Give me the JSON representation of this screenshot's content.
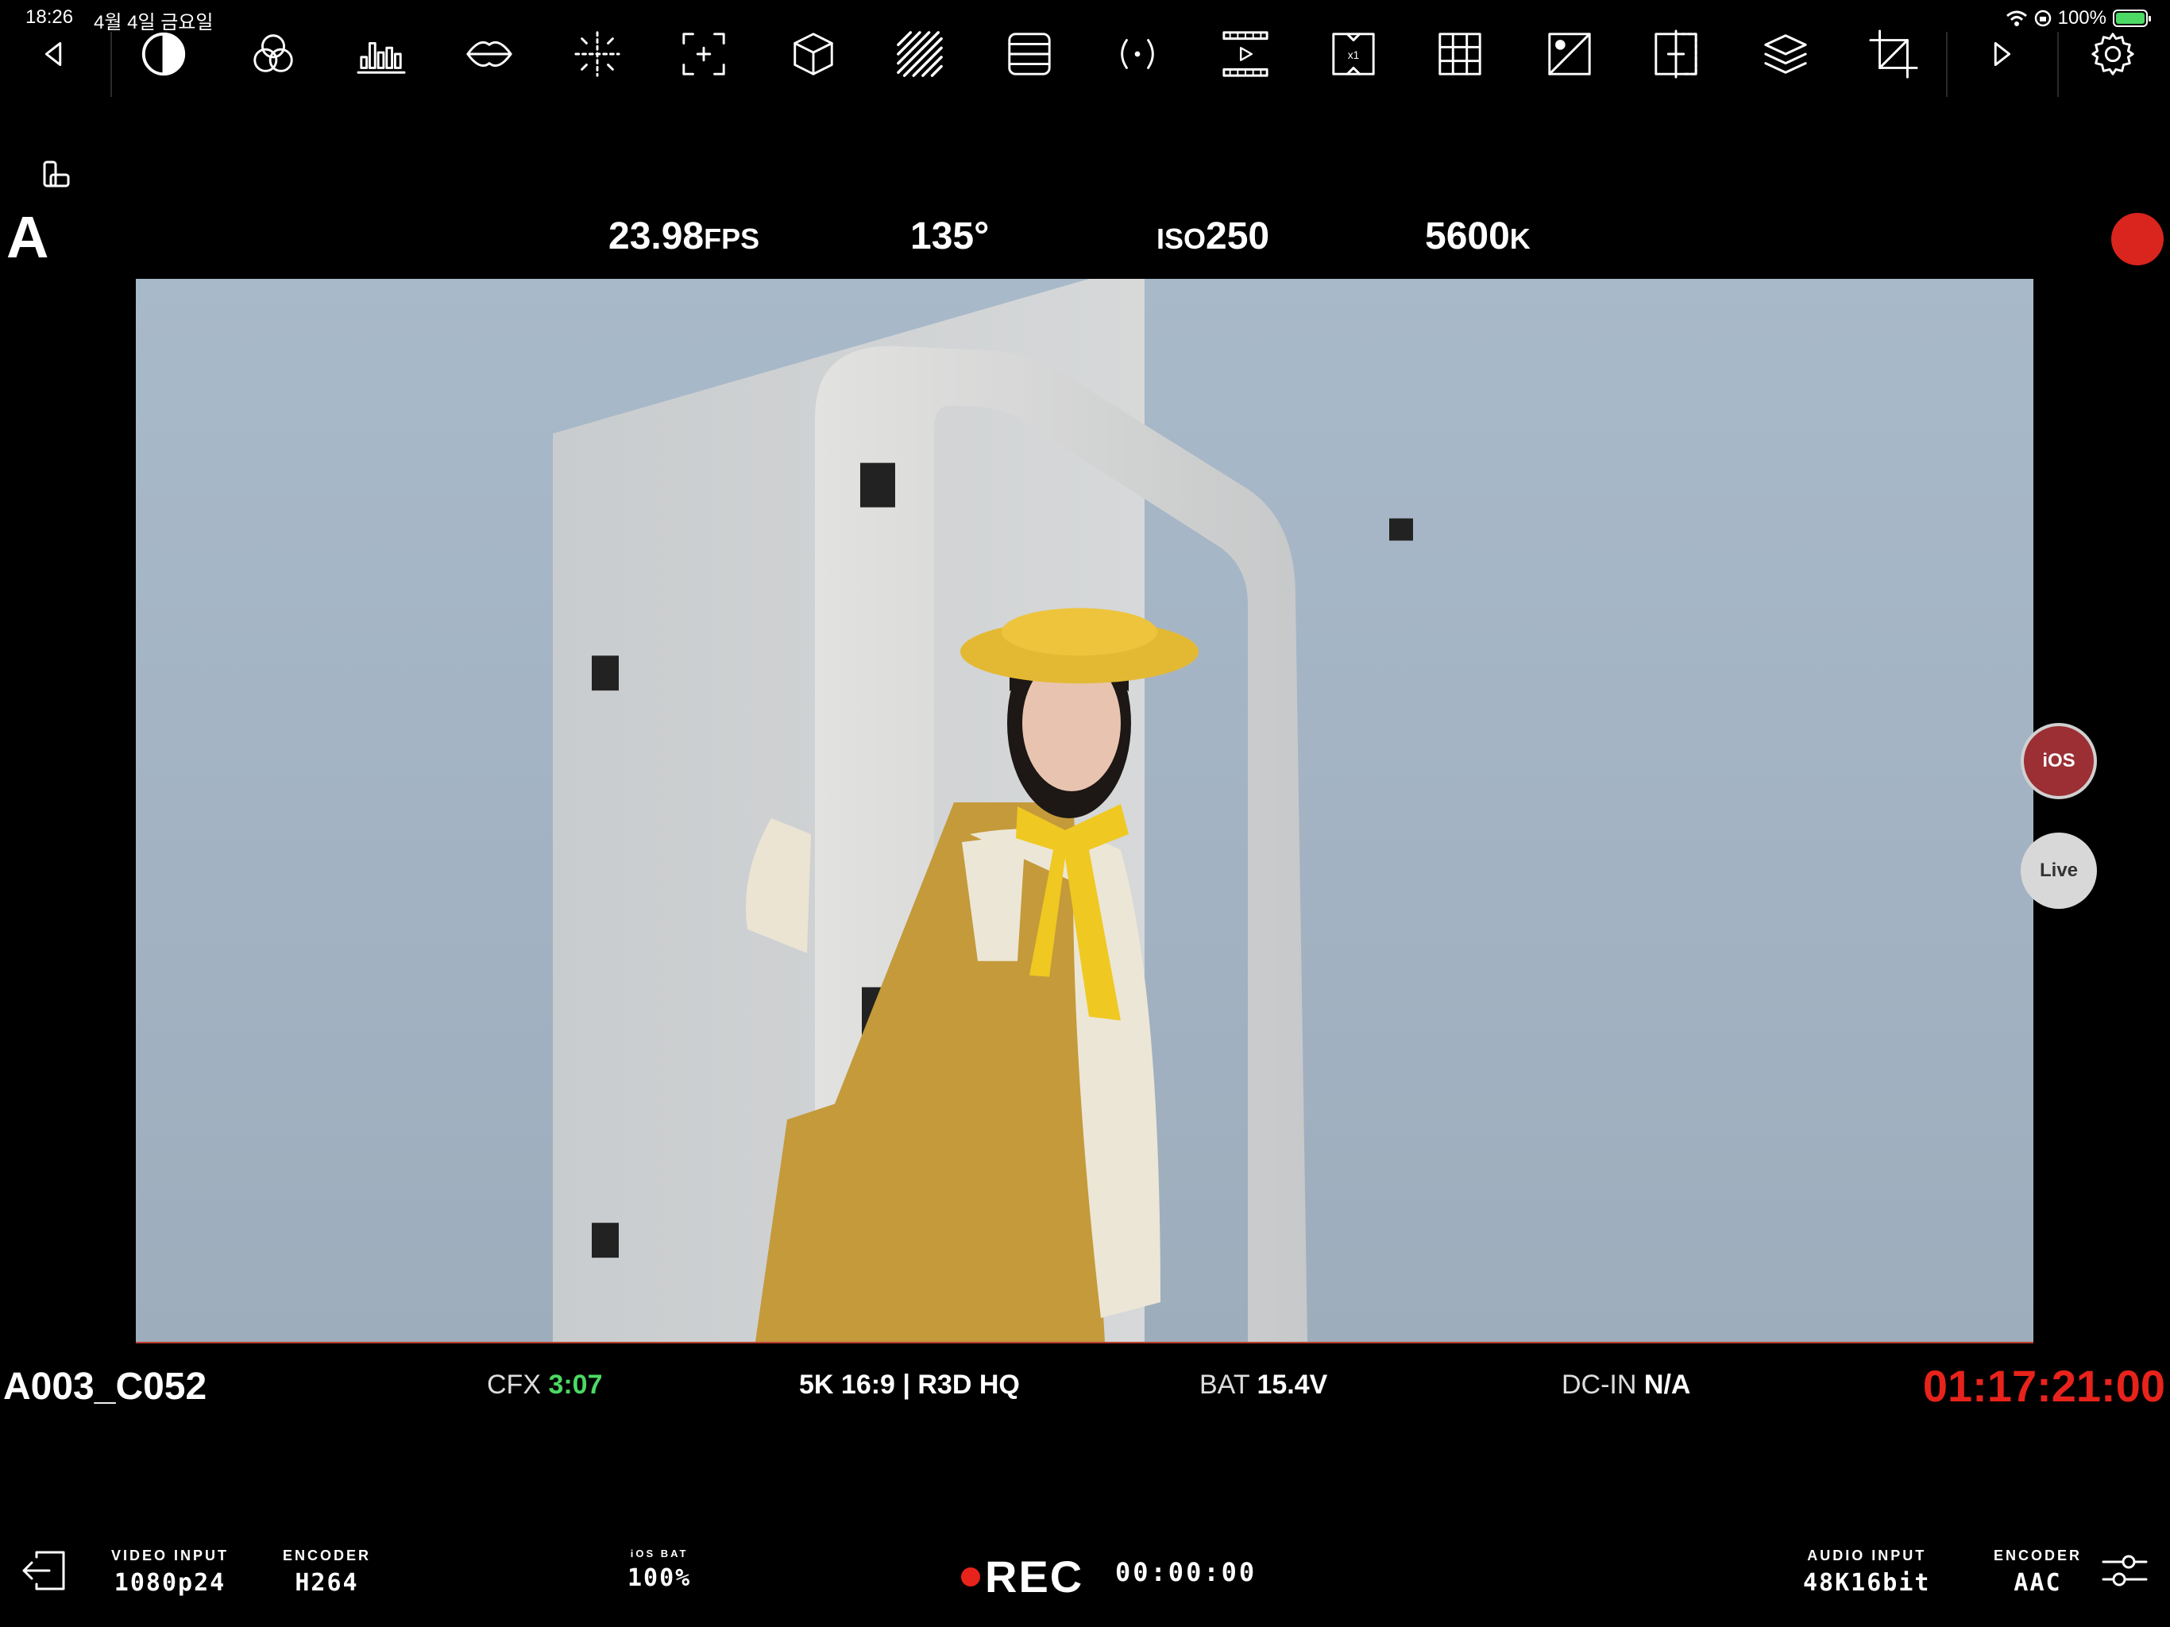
{
  "status_bar": {
    "time": "18:26",
    "date": "4월 4일 금요일",
    "battery": "100%"
  },
  "toolbar": {
    "icons": [
      "back-icon",
      "contrast-icon",
      "color-channels-icon",
      "histogram-icon",
      "waveform-icon",
      "focus-peaking-icon",
      "frame-guide-icon",
      "cube-lut-icon",
      "zebra-icon",
      "false-color-icon",
      "broadcast-icon",
      "filmstrip-play-icon",
      "desqueeze-icon",
      "grid-icon",
      "exposure-icon",
      "split-compare-icon",
      "layers-icon",
      "crop-icon",
      "forward-icon",
      "settings-icon"
    ]
  },
  "camera": {
    "label": "A",
    "fps_value": "23.98",
    "fps_unit": "FPS",
    "shutter": "135°",
    "iso_prefix": "ISO",
    "iso_value": "250",
    "wb_value": "5600",
    "wb_unit": "K"
  },
  "side_buttons": {
    "ios": "iOS",
    "live": "Live"
  },
  "clip": {
    "name": "A003_C052",
    "cfx_label": "CFX",
    "cfx_value": "3:07",
    "format": "5K 16:9 | R3D HQ",
    "bat_label": "BAT",
    "bat_value": "15.4V",
    "dcin_label": "DC-IN",
    "dcin_value": "N/A",
    "timecode": "01:17:21:00"
  },
  "bottom_bar": {
    "video_input_label": "VIDEO INPUT",
    "video_input_value": "1080p24",
    "video_encoder_label": "ENCODER",
    "video_encoder_value": "H264",
    "ios_bat_label": "iOS BAT",
    "ios_bat_value": "100%",
    "rec_label": "REC",
    "rec_time": "00:00:00",
    "audio_input_label": "AUDIO INPUT",
    "audio_input_value": "48K16bit",
    "audio_encoder_label": "ENCODER",
    "audio_encoder_value": "AAC"
  },
  "colors": {
    "record_red": "#e8231b",
    "cfx_green": "#4cd964",
    "ios_button": "#9b2f33"
  }
}
